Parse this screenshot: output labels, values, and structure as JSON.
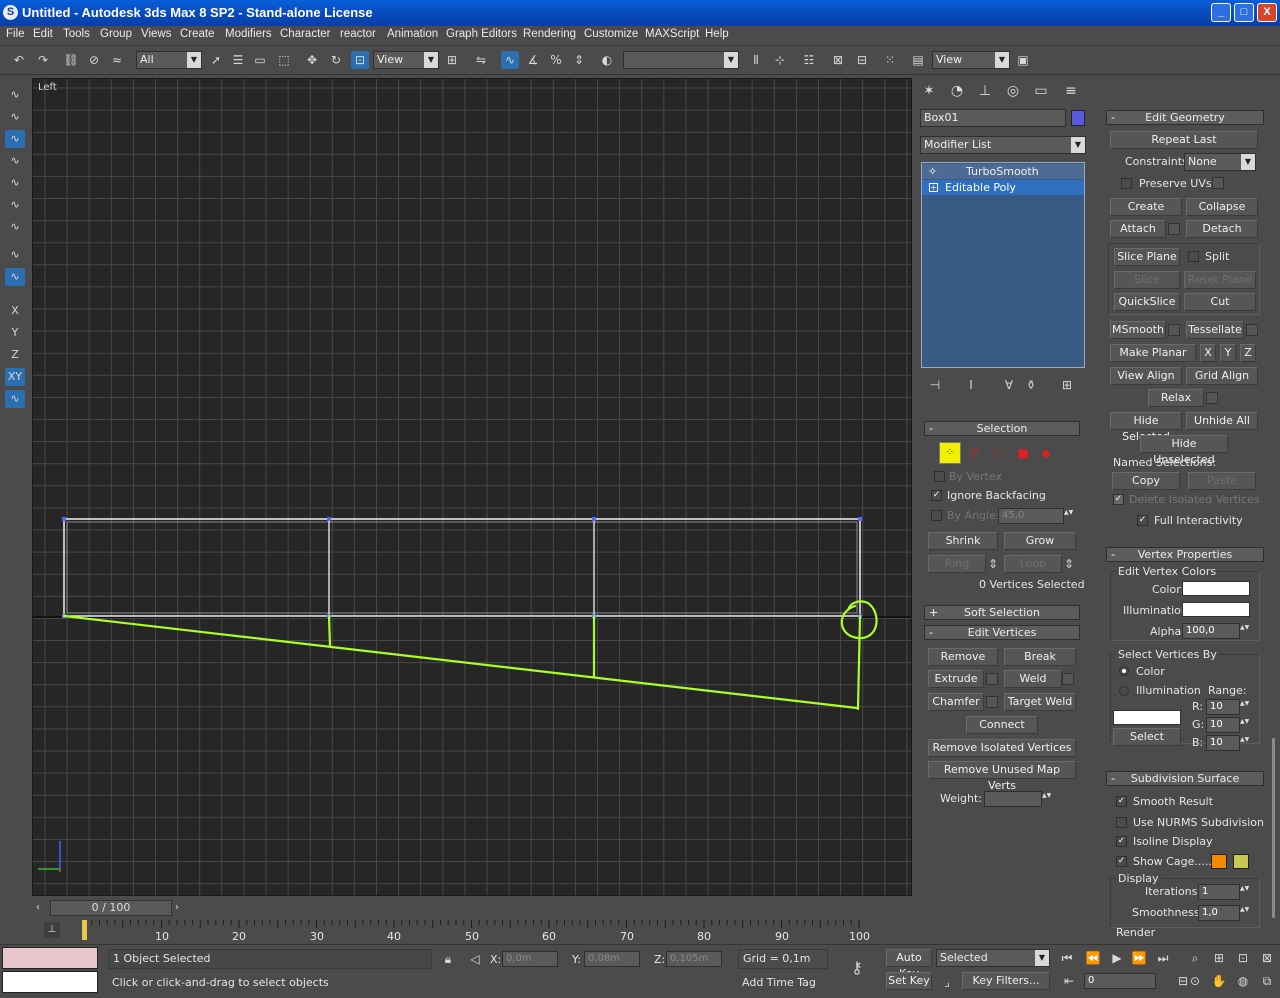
{
  "window": {
    "title": "Untitled - Autodesk 3ds Max 8 SP2  - Stand-alone License",
    "logo": "S",
    "controls": {
      "minimize": "_",
      "maximize": "□",
      "close": "X"
    }
  },
  "menu": [
    "File",
    "Edit",
    "Tools",
    "Group",
    "Views",
    "Create",
    "Modifiers",
    "Character",
    "reactor",
    "Animation",
    "Graph Editors",
    "Rendering",
    "Customize",
    "MAXScript",
    "Help"
  ],
  "toolbar": {
    "selection_filter": "All",
    "ref_coord_1": "View",
    "named_selection": "",
    "ref_coord_2": "View",
    "icons": [
      "undo-icon",
      "redo-icon",
      "link-icon",
      "unlink-icon",
      "bind-spacewarp-icon",
      "select-filter-icon",
      "select-object-icon",
      "select-by-name-icon",
      "rect-region-icon",
      "window-crossing-icon",
      "move-icon",
      "rotate-icon",
      "scale-icon",
      "pivot-icon",
      "snap-3d-icon",
      "angle-snap-icon",
      "percent-snap-icon",
      "spinner-snap-icon",
      "edit-named-icon",
      "mirror-icon",
      "align-icon",
      "layer-icon",
      "curve-editor-icon",
      "schematic-icon",
      "material-icon",
      "render-scene-icon",
      "quick-render-icon"
    ]
  },
  "left_toolbar": {
    "items": [
      "XY",
      "X",
      "Y",
      "Z"
    ],
    "axis_labels": [
      "X",
      "Y",
      "Z",
      "XY"
    ]
  },
  "viewport": {
    "label": "Left",
    "accent_color": "#aaff2a",
    "wire_color": "#ffffff",
    "grid_color": "#484848"
  },
  "command_panel": {
    "tabs": [
      "create-tab-icon",
      "modify-tab-icon",
      "hierarchy-tab-icon",
      "motion-tab-icon",
      "display-tab-icon",
      "utilities-tab-icon"
    ],
    "object_name": "Box01",
    "object_color": "#5a5ae0",
    "modifier_list": "Modifier List",
    "stack": [
      "TurboSmooth",
      "Editable Poly"
    ],
    "stack_icons": [
      "pin-stack-icon",
      "show-end-result-icon",
      "make-unique-icon",
      "remove-modifier-icon",
      "configure-sets-icon"
    ],
    "selection": {
      "header": "Selection",
      "by_vertex": "By Vertex",
      "ignore_backfacing": "Ignore Backfacing",
      "by_angle": "By Angle:",
      "angle": "45,0",
      "shrink": "Shrink",
      "grow": "Grow",
      "ring": "Ring",
      "loop": "Loop",
      "status": "0 Vertices Selected"
    },
    "soft_selection": "Soft Selection",
    "edit_vertices": {
      "header": "Edit Vertices",
      "remove": "Remove",
      "break": "Break",
      "extrude": "Extrude",
      "weld": "Weld",
      "chamfer": "Chamfer",
      "target_weld": "Target Weld",
      "connect": "Connect",
      "remove_isolated": "Remove Isolated Vertices",
      "remove_unused": "Remove Unused Map Verts",
      "weight_label": "Weight:",
      "weight": ""
    },
    "edit_geometry": {
      "header": "Edit Geometry",
      "repeat_last": "Repeat Last",
      "constraints_label": "Constraints:",
      "constraints": "None",
      "preserve_uvs": "Preserve UVs",
      "create": "Create",
      "collapse": "Collapse",
      "attach": "Attach",
      "detach": "Detach",
      "slice_plane": "Slice Plane",
      "split": "Split",
      "slice": "Slice",
      "reset_plane": "Reset Plane",
      "quickslice": "QuickSlice",
      "cut": "Cut",
      "msmooth": "MSmooth",
      "tessellate": "Tessellate",
      "make_planar": "Make Planar",
      "x": "X",
      "y": "Y",
      "z": "Z",
      "view_align": "View Align",
      "grid_align": "Grid Align",
      "relax": "Relax",
      "hide_selected": "Hide Selected",
      "unhide_all": "Unhide All",
      "hide_unselected": "Hide Unselected",
      "named_selections": "Named Selections:",
      "copy": "Copy",
      "paste": "Paste",
      "delete_isolated": "Delete Isolated Vertices",
      "full_interactivity": "Full Interactivity"
    },
    "vertex_properties": {
      "header": "Vertex Properties",
      "edit_colors": "Edit Vertex Colors",
      "color_label": "Color:",
      "illum_label": "Illumination:",
      "alpha_label": "Alpha:",
      "alpha": "100,0",
      "select_by": "Select Vertices By",
      "by_color": "Color",
      "by_illum": "Illumination",
      "range": "Range:",
      "r_label": "R:",
      "r": "10",
      "g_label": "G:",
      "g": "10",
      "b_label": "B:",
      "b": "10",
      "select": "Select"
    },
    "subdivision": {
      "header": "Subdivision Surface",
      "smooth_result": "Smooth Result",
      "use_nurms": "Use NURMS Subdivision",
      "isoline": "Isoline Display",
      "show_cage": "Show Cage......",
      "cage_color_1": "#f08a00",
      "cage_color_2": "#c8c850",
      "display": "Display",
      "iterations_label": "Iterations:",
      "iterations": "1",
      "smoothness_label": "Smoothness:",
      "smoothness": "1,0",
      "render": "Render"
    }
  },
  "timeline": {
    "frame": "0 / 100",
    "ticks": [
      "10",
      "20",
      "30",
      "40",
      "50",
      "60",
      "70",
      "80",
      "90",
      "100"
    ]
  },
  "status": {
    "objects": "1 Object Selected",
    "prompt": "Click or click-and-drag to select objects",
    "x_label": "X:",
    "x": "0,0m",
    "y_label": "Y:",
    "y": "0,08m",
    "z_label": "Z:",
    "z": "0,105m",
    "grid": "Grid = 0,1m",
    "add_time_tag": "Add Time Tag",
    "auto_key": "Auto Key",
    "set_key": "Set Key",
    "selected": "Selected",
    "key_filters": "Key Filters...",
    "frame_field": "0"
  }
}
